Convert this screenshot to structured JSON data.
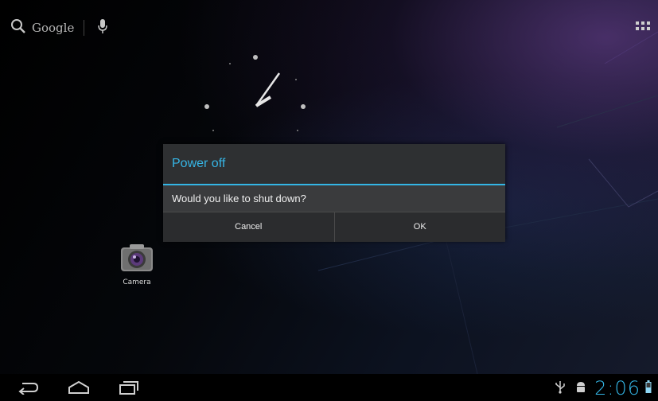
{
  "search": {
    "label": "Google"
  },
  "dialog": {
    "title": "Power off",
    "message": "Would you like to shut down?",
    "cancel": "Cancel",
    "ok": "OK"
  },
  "apps": [
    {
      "label": "Camera",
      "icon": "camera-icon"
    }
  ],
  "status": {
    "time": "2:06"
  },
  "colors": {
    "accent": "#33b5e5",
    "dialog_bg": "#2b2c2e"
  },
  "icons": [
    "search-icon",
    "mic-icon",
    "apps-grid-icon",
    "camera-icon",
    "back-icon",
    "home-icon",
    "recents-icon",
    "usb-icon",
    "android-debug-icon",
    "battery-icon"
  ]
}
